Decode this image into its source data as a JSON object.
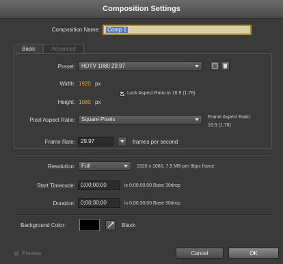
{
  "window": {
    "title": "Composition Settings"
  },
  "composition_name": {
    "label": "Composition Name:",
    "value": "Comp 1"
  },
  "tabs": [
    {
      "label": "Basic"
    },
    {
      "label": "Advanced"
    }
  ],
  "basic": {
    "preset": {
      "label": "Preset:",
      "value": "HDTV 1080 29.97"
    },
    "width": {
      "label": "Width:",
      "value": "1920",
      "unit": "px"
    },
    "height": {
      "label": "Height:",
      "value": "1080",
      "unit": "px"
    },
    "lock_aspect": {
      "label": "Lock Aspect Ratio to 16:9 (1.78)",
      "checked": true
    },
    "pixel_aspect": {
      "label": "Pixel Aspect Ratio:",
      "value": "Square Pixels"
    },
    "frame_aspect": {
      "label": "Frame Aspect Ratio:",
      "value": "16:9 (1.78)"
    },
    "frame_rate": {
      "label": "Frame Rate:",
      "value": "29.97",
      "unit": "frames per second"
    },
    "resolution": {
      "label": "Resolution:",
      "value": "Full",
      "info": "1920 x 1080, 7.9 MB per 8bpc frame"
    },
    "start_timecode": {
      "label": "Start Timecode:",
      "value": "0;00;00;00",
      "info": "is 0;00;00;00  Base 30drop"
    },
    "duration": {
      "label": "Duration:",
      "value": "0;00;30;00",
      "info": "is 0;00;30;00  Base 30drop"
    },
    "background_color": {
      "label": "Background Color:",
      "name": "Black",
      "color": "#000000"
    }
  },
  "footer": {
    "preview": {
      "label": "Preview",
      "checked": false
    },
    "cancel_label": "Cancel",
    "ok_label": "OK"
  }
}
